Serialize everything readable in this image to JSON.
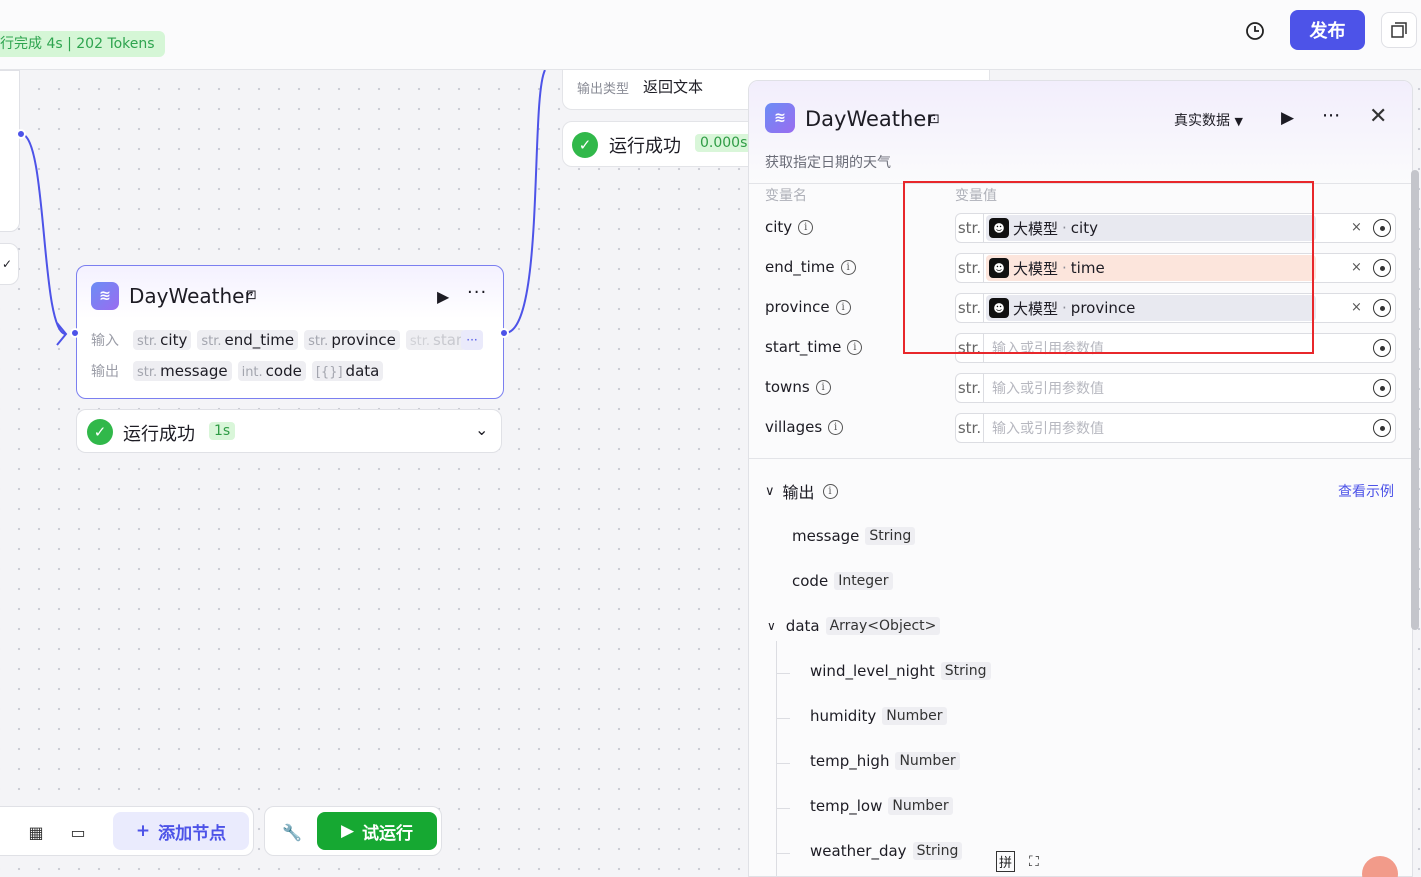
{
  "topbar": {
    "run_status": "行完成 4s | 202 Tokens",
    "publish_label": "发布",
    "history_icon": "history-icon",
    "layout_icon": "layout-icon"
  },
  "top_card": {
    "output_type_label": "输出类型",
    "output_type_value": "返回文本"
  },
  "top_status": {
    "label": "运行成功",
    "time": "0.000s"
  },
  "node": {
    "title": "DayWeather",
    "input_label": "输入",
    "output_label": "输出",
    "inputs": [
      {
        "type": "str.",
        "name": "city"
      },
      {
        "type": "str.",
        "name": "end_time"
      },
      {
        "type": "str.",
        "name": "province"
      },
      {
        "type": "str.",
        "name": "star"
      }
    ],
    "outputs": [
      {
        "type": "str.",
        "name": "message"
      },
      {
        "type": "int.",
        "name": "code"
      },
      {
        "type": "[{}]",
        "name": "data"
      }
    ],
    "more_chip": "···"
  },
  "node_status": {
    "label": "运行成功",
    "time": "1s"
  },
  "toolbar": {
    "add_node_label": "添加节点",
    "try_run_label": "试运行"
  },
  "panel": {
    "title": "DayWeather",
    "description": "获取指定日期的天气",
    "real_data_label": "真实数据",
    "col_name": "变量名",
    "col_value": "变量值",
    "variables": [
      {
        "name": "city",
        "type": "str.",
        "source": "大模型",
        "ref": "city",
        "placeholder": ""
      },
      {
        "name": "end_time",
        "type": "str.",
        "source": "大模型",
        "ref": "time",
        "placeholder": ""
      },
      {
        "name": "province",
        "type": "str.",
        "source": "大模型",
        "ref": "province",
        "placeholder": ""
      },
      {
        "name": "start_time",
        "type": "str.",
        "source": "",
        "ref": "",
        "placeholder": "输入或引用参数值"
      },
      {
        "name": "towns",
        "type": "str.",
        "source": "",
        "ref": "",
        "placeholder": "输入或引用参数值"
      },
      {
        "name": "villages",
        "type": "str.",
        "source": "",
        "ref": "",
        "placeholder": "输入或引用参数值"
      }
    ],
    "output_header": "输出",
    "view_example": "查看示例",
    "outputs": [
      {
        "name": "message",
        "type": "String"
      },
      {
        "name": "code",
        "type": "Integer"
      },
      {
        "name": "data",
        "type": "Array<Object>"
      }
    ],
    "data_children": [
      {
        "name": "wind_level_night",
        "type": "String"
      },
      {
        "name": "humidity",
        "type": "Number"
      },
      {
        "name": "temp_high",
        "type": "Number"
      },
      {
        "name": "temp_low",
        "type": "Number"
      },
      {
        "name": "weather_day",
        "type": "String"
      }
    ]
  },
  "ime": {
    "label": "拼"
  },
  "colors": {
    "accent": "#4d53e8",
    "success": "#31b84a",
    "highlight_box": "#e8272b"
  }
}
